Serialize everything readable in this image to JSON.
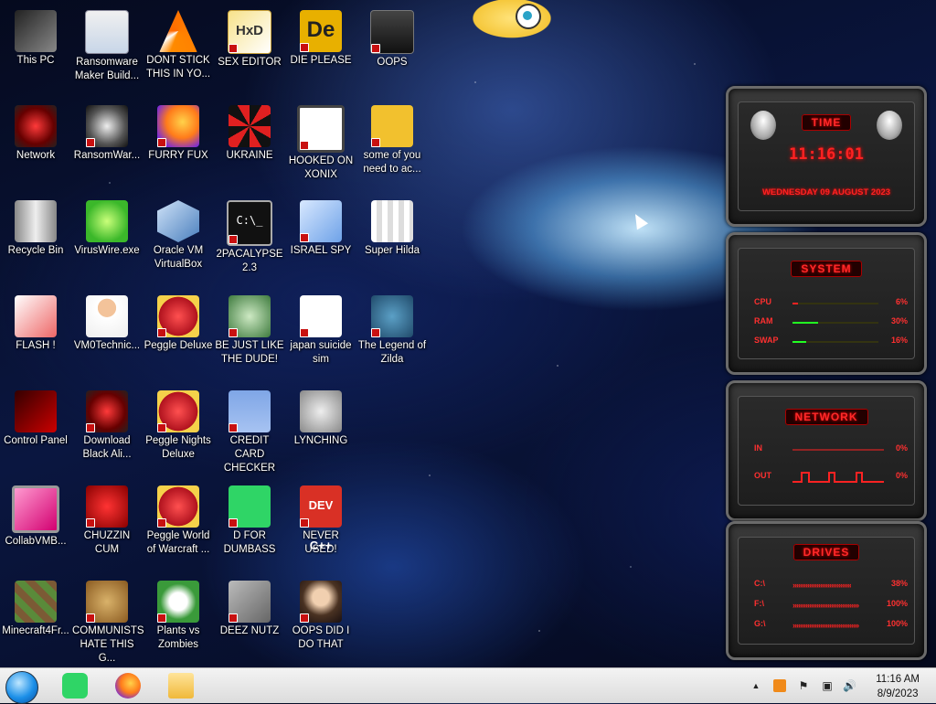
{
  "desktop": {
    "icons": [
      {
        "label": "This PC"
      },
      {
        "label": "Ransomware Maker Build..."
      },
      {
        "label": "DONT STICK THIS IN YO..."
      },
      {
        "label": "SEX EDITOR"
      },
      {
        "label": "DIE PLEASE"
      },
      {
        "label": "OOPS"
      },
      {
        "label": "Network"
      },
      {
        "label": "RansomWar..."
      },
      {
        "label": "FURRY FUX"
      },
      {
        "label": "UKRAINE"
      },
      {
        "label": "HOOKED ON XONIX"
      },
      {
        "label": "some of you need to ac..."
      },
      {
        "label": "Recycle Bin"
      },
      {
        "label": "VirusWire.exe"
      },
      {
        "label": "Oracle VM VirtualBox"
      },
      {
        "label": "2PACALYPSE 2.3"
      },
      {
        "label": "ISRAEL SPY"
      },
      {
        "label": "Super Hilda"
      },
      {
        "label": "FLASH !"
      },
      {
        "label": "VM0Technic..."
      },
      {
        "label": "Peggle Deluxe"
      },
      {
        "label": "BE JUST LIKE THE DUDE!"
      },
      {
        "label": "japan suicide sim"
      },
      {
        "label": "The Legend of Zilda"
      },
      {
        "label": "Control Panel"
      },
      {
        "label": "Download Black Ali..."
      },
      {
        "label": "Peggle Nights Deluxe"
      },
      {
        "label": "CREDIT CARD CHECKER"
      },
      {
        "label": "LYNCHING"
      },
      {
        "label": "CollabVMB..."
      },
      {
        "label": "CHUZZIN CUM"
      },
      {
        "label": "Peggle World of Warcraft ..."
      },
      {
        "label": "D FOR DUMBASS"
      },
      {
        "label": "NEVER USED!"
      },
      {
        "label": "Minecraft4Fr..."
      },
      {
        "label": "COMMUNISTS HATE THIS G..."
      },
      {
        "label": "Plants vs Zombies"
      },
      {
        "label": "DEEZ NUTZ"
      },
      {
        "label": "OOPS DID I DO THAT"
      }
    ],
    "glyphs": {
      "hxd": "HxD",
      "de": "De",
      "cmd": "C:\\_",
      "dev": "DEV C++"
    }
  },
  "gadget": {
    "time": {
      "header": "TIME",
      "clock": "11:16:01",
      "date": "WEDNESDAY 09 AUGUST 2023"
    },
    "system": {
      "header": "SYSTEM",
      "rows": [
        {
          "key": "CPU",
          "value": "6%",
          "level": 0.06
        },
        {
          "key": "RAM",
          "value": "30%",
          "level": 0.3
        },
        {
          "key": "SWAP",
          "value": "16%",
          "level": 0.16
        }
      ]
    },
    "network": {
      "header": "NETWORK",
      "rows": [
        {
          "key": "IN",
          "value": "0%"
        },
        {
          "key": "OUT",
          "value": "0%"
        }
      ]
    },
    "drives": {
      "header": "DRIVES",
      "rows": [
        {
          "key": "C:\\",
          "value": "38%",
          "level": 0.38
        },
        {
          "key": "F:\\",
          "value": "100%",
          "level": 1.0
        },
        {
          "key": "G:\\",
          "value": "100%",
          "level": 1.0
        }
      ]
    }
  },
  "taskbar": {
    "pinned": [
      "start-orb",
      "spotify-icon",
      "firefox-icon",
      "file-explorer-icon"
    ],
    "tray": {
      "expand": "▲"
    },
    "clock": {
      "time": "11:16 AM",
      "date": "8/9/2023"
    }
  }
}
